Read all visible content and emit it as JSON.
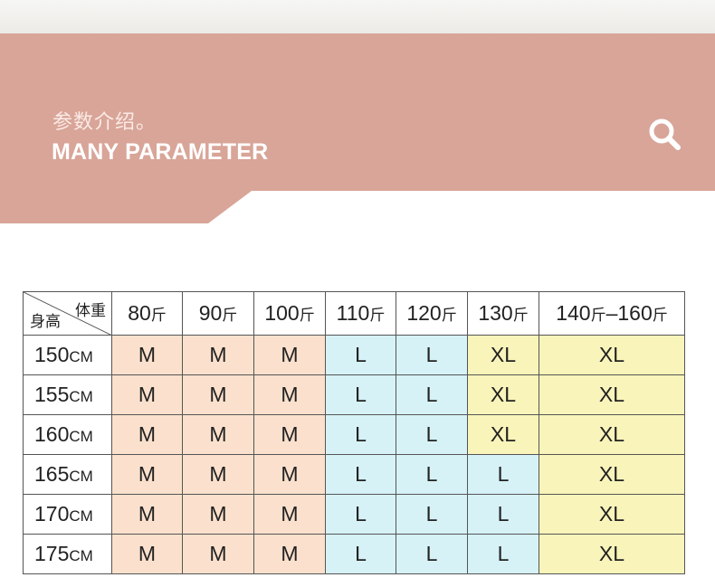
{
  "banner": {
    "subtitle": "参数介绍。",
    "title": "MANY PARAMETER",
    "colors": {
      "pink": "#d8a598",
      "text": "#ffffff"
    },
    "icon": "search-icon"
  },
  "size_table": {
    "corner_weight_label": "体重",
    "corner_height_label": "身高",
    "weight_columns": [
      {
        "num": "80",
        "unit": "斤"
      },
      {
        "num": "90",
        "unit": "斤"
      },
      {
        "num": "100",
        "unit": "斤"
      },
      {
        "num": "110",
        "unit": "斤"
      },
      {
        "num": "120",
        "unit": "斤"
      },
      {
        "num": "130",
        "unit": "斤"
      },
      {
        "num": "140",
        "unit": "斤",
        "num2": "–160",
        "unit2": "斤"
      }
    ],
    "rows": [
      {
        "height": "150",
        "unit": "CM",
        "sizes": [
          "M",
          "M",
          "M",
          "L",
          "L",
          "XL",
          "XL"
        ]
      },
      {
        "height": "155",
        "unit": "CM",
        "sizes": [
          "M",
          "M",
          "M",
          "L",
          "L",
          "XL",
          "XL"
        ]
      },
      {
        "height": "160",
        "unit": "CM",
        "sizes": [
          "M",
          "M",
          "M",
          "L",
          "L",
          "XL",
          "XL"
        ]
      },
      {
        "height": "165",
        "unit": "CM",
        "sizes": [
          "M",
          "M",
          "M",
          "L",
          "L",
          "L",
          "XL"
        ]
      },
      {
        "height": "170",
        "unit": "CM",
        "sizes": [
          "M",
          "M",
          "M",
          "L",
          "L",
          "L",
          "XL"
        ]
      },
      {
        "height": "175",
        "unit": "CM",
        "sizes": [
          "M",
          "M",
          "M",
          "L",
          "L",
          "L",
          "XL"
        ]
      }
    ],
    "size_colors": {
      "M": "#fbe1cd",
      "L": "#d6f2f7",
      "XL": "#f9f4ba"
    }
  }
}
